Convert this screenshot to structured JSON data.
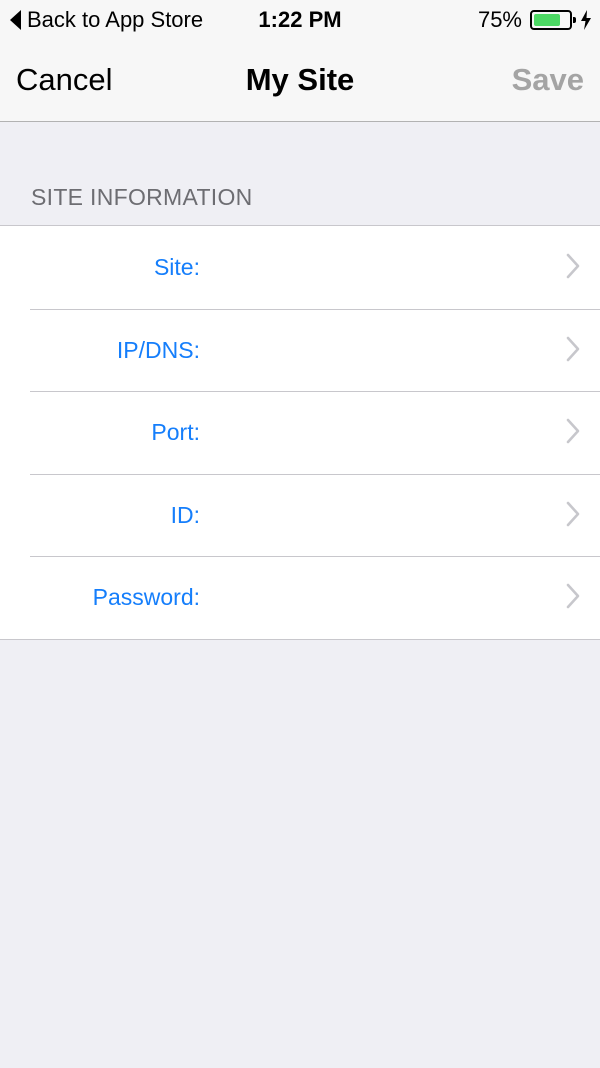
{
  "status_bar": {
    "back_label": "Back to App Store",
    "time": "1:22 PM",
    "battery_percent_label": "75%",
    "battery_level": 0.75,
    "battery_color": "#4cd964"
  },
  "nav": {
    "cancel_label": "Cancel",
    "title": "My Site",
    "save_label": "Save"
  },
  "section": {
    "header": "SITE INFORMATION"
  },
  "rows": [
    {
      "label": "Site:"
    },
    {
      "label": "IP/DNS:"
    },
    {
      "label": "Port:"
    },
    {
      "label": "ID:"
    },
    {
      "label": "Password:"
    }
  ],
  "colors": {
    "accent": "#157efb",
    "disabled": "#a4a4a4",
    "background": "#efeff4"
  }
}
